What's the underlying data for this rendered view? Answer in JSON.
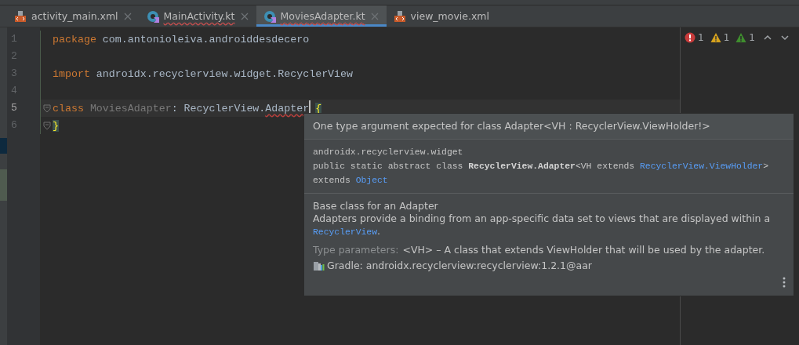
{
  "tabs": [
    {
      "label": "activity_main.xml",
      "kind": "xml",
      "selected": false,
      "error": false,
      "closable": true
    },
    {
      "label": "MainActivity.kt",
      "kind": "kotlin",
      "selected": false,
      "error": true,
      "closable": true
    },
    {
      "label": "MoviesAdapter.kt",
      "kind": "kotlin",
      "selected": true,
      "error": true,
      "closable": true
    },
    {
      "label": "view_movie.xml",
      "kind": "xml",
      "selected": false,
      "error": false,
      "closable": false
    }
  ],
  "editor": {
    "lines": [
      {
        "number": "1",
        "current": false,
        "tokens": [
          {
            "text": "package",
            "kind": "keyword"
          },
          {
            "text": " com.antonioleiva.androiddesdecero",
            "kind": "plain"
          }
        ]
      },
      {
        "number": "2",
        "current": false
      },
      {
        "number": "3",
        "current": false,
        "tokens": [
          {
            "text": "import",
            "kind": "keyword"
          },
          {
            "text": " androidx.recyclerview.widget.RecyclerView",
            "kind": "plain"
          }
        ]
      },
      {
        "number": "4",
        "current": false
      },
      {
        "number": "5",
        "current": true,
        "tokens": [
          {
            "text": "class",
            "kind": "keyword"
          },
          {
            "text": " MoviesAdapter",
            "kind": "muted"
          },
          {
            "text": ": RecyclerView.",
            "kind": "plain"
          },
          {
            "text": "Adapter",
            "kind": "error",
            "caret": true
          },
          {
            "text": "{",
            "kind": "brace"
          }
        ]
      },
      {
        "number": "6",
        "current": false,
        "tokens": [
          {
            "text": "}",
            "kind": "brace"
          }
        ]
      }
    ],
    "inspections": [
      {
        "kind": "error",
        "count": "1"
      },
      {
        "kind": "warning",
        "count": "1"
      },
      {
        "kind": "weak_warning",
        "count": "1"
      }
    ]
  },
  "popup": {
    "title": "One type argument expected for class Adapter<VH : RecyclerView.ViewHolder!>",
    "package": "androidx.recyclerview.widget",
    "signature": [
      [
        {
          "text": "public static abstract class ",
          "kind": "plain"
        },
        {
          "text": "RecyclerView.Adapter",
          "kind": "bold"
        },
        {
          "text": "<VH extends ",
          "kind": "plain"
        },
        {
          "text": "RecyclerView.ViewHolder",
          "kind": "link"
        },
        {
          "text": ">",
          "kind": "plain"
        }
      ],
      [
        {
          "text": "extends ",
          "kind": "plain"
        },
        {
          "text": "Object",
          "kind": "link"
        }
      ]
    ],
    "summary": "Base class for an Adapter",
    "description": [
      {
        "text": "Adapters provide a binding from an app-specific data set to views that are displayed within a ",
        "kind": "plain"
      },
      {
        "text": "RecyclerView",
        "kind": "link"
      },
      {
        "text": ".",
        "kind": "plain"
      }
    ],
    "params_label": "Type parameters:",
    "params_text": "<VH> – A class that extends ViewHolder that will be used by the adapter.",
    "gradle": "Gradle: androidx.recyclerview:recyclerview:1.2.1@aar"
  }
}
